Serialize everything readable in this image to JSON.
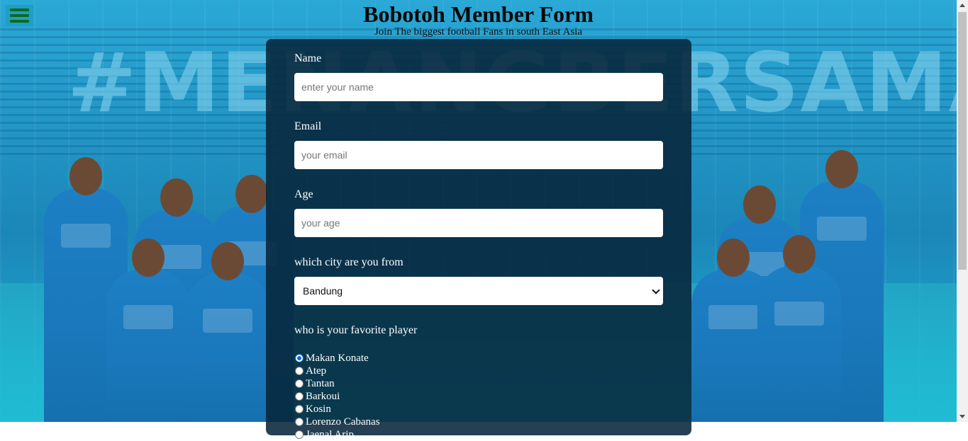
{
  "header": {
    "title": "Bobotoh Member Form",
    "subtitle": "Join The biggest football Fans in south East Asia"
  },
  "background": {
    "hashtag": "#MENANGBERSAMA"
  },
  "menu": {
    "icon": "hamburger-menu-icon",
    "color": "#0c6b1a"
  },
  "form": {
    "name": {
      "label": "Name",
      "placeholder": "enter your name"
    },
    "email": {
      "label": "Email",
      "placeholder": "your email"
    },
    "age": {
      "label": "Age",
      "placeholder": "your age"
    },
    "city": {
      "label": "which city are you from",
      "selected": "Bandung"
    },
    "favorite_player": {
      "label": "who is your favorite player",
      "selected": "Makan Konate",
      "options": [
        "Makan Konate",
        "Atep",
        "Tantan",
        "Barkoui",
        "Kosin",
        "Lorenzo Cabanas",
        "Jaenal Arip"
      ]
    }
  },
  "colors": {
    "form_background": "#07263a",
    "page_background": "#2296c6",
    "radio_accent": "#0b66d8"
  }
}
